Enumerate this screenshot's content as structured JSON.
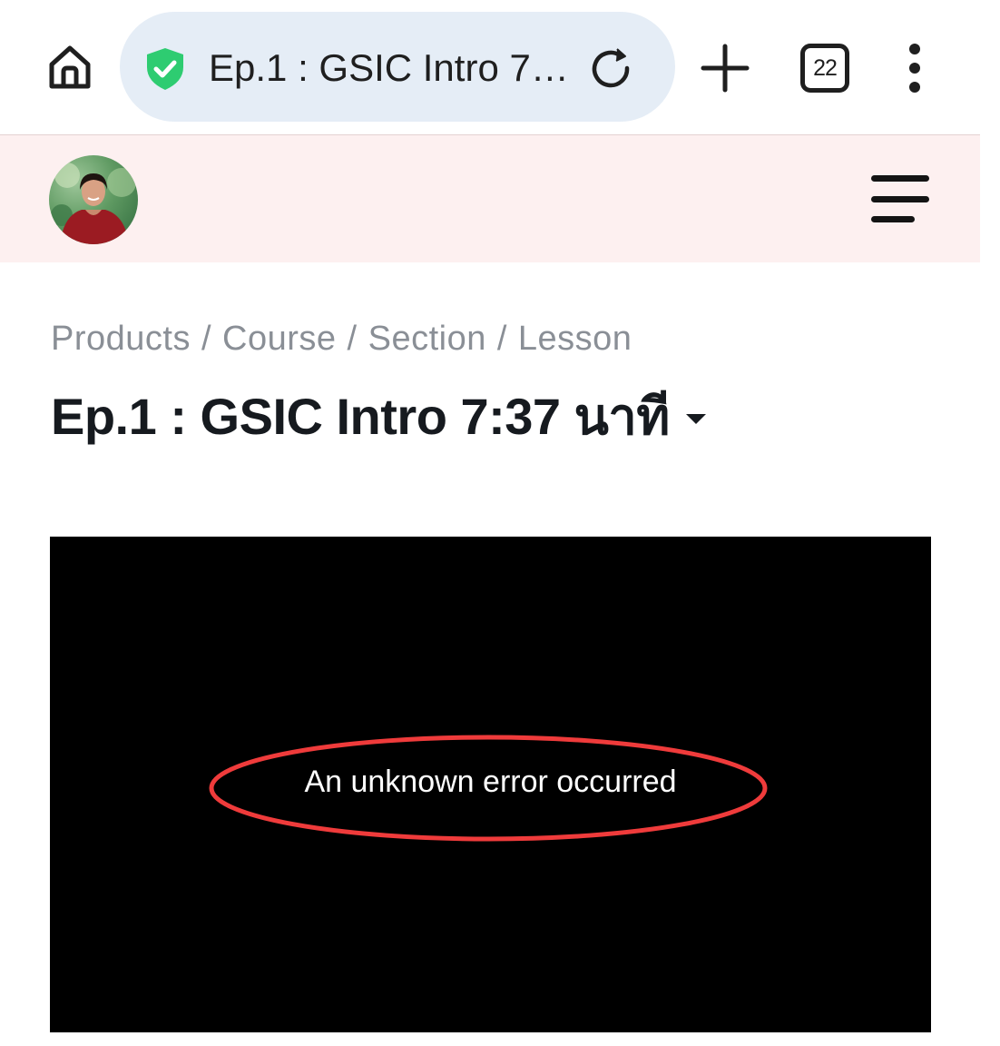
{
  "browser": {
    "url_title": "Ep.1 : GSIC Intro 7…",
    "tab_count": "22",
    "security": "shield-check-icon",
    "accent_shield": "#2ecc71"
  },
  "site": {
    "header_bg": "#fdf0f0"
  },
  "breadcrumb": {
    "items": [
      "Products",
      "Course",
      "Section",
      "Lesson"
    ],
    "separator": "/"
  },
  "lesson": {
    "title": "Ep.1 : GSIC Intro 7:37 นาที"
  },
  "video": {
    "error_message": "An unknown error occurred",
    "highlight_color": "#ef3b3b"
  }
}
